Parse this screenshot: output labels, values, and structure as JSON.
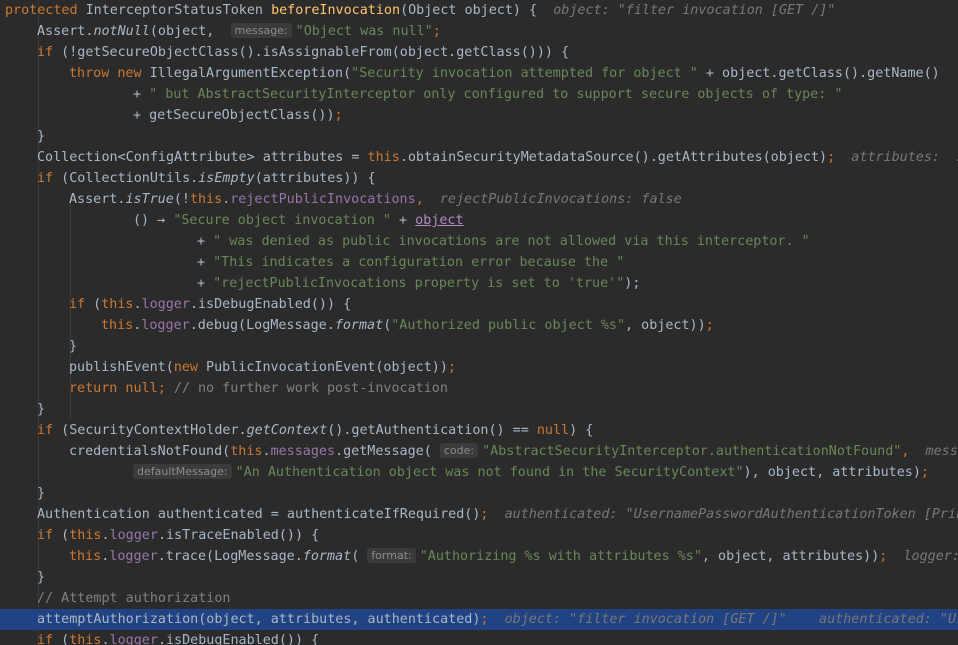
{
  "editor": {
    "language": "java",
    "colors": {
      "background": "#2b2b2b",
      "keyword": "#cc7832",
      "method_declaration": "#ffc66d",
      "string": "#6a8759",
      "field": "#9876aa",
      "comment": "#808080",
      "inlay_hint": "#787878",
      "current_line": "#214283"
    },
    "current_line_index": 29,
    "lines": [
      {
        "indent": 0,
        "tokens": [
          {
            "t": "protected",
            "c": "kw"
          },
          {
            "t": " "
          },
          {
            "t": "InterceptorStatusToken "
          },
          {
            "t": "beforeInvocation",
            "c": "fn"
          },
          {
            "t": "(Object object) {  "
          },
          {
            "t": "object: \"filter invocation [GET /]\"",
            "c": "hint"
          }
        ]
      },
      {
        "indent": 1,
        "tokens": [
          {
            "t": "Assert."
          },
          {
            "t": "notNull",
            "c": "it"
          },
          {
            "t": "(object,  "
          },
          {
            "t": "message:",
            "c": "param"
          },
          {
            "t": "\"Object was null\"",
            "c": "str"
          },
          {
            "t": ";",
            "c": "kw"
          }
        ]
      },
      {
        "indent": 1,
        "tokens": [
          {
            "t": "if",
            "c": "kw"
          },
          {
            "t": " (!getSecureObjectClass().isAssignableFrom(object.getClass())) {"
          }
        ]
      },
      {
        "indent": 2,
        "tokens": [
          {
            "t": "throw new",
            "c": "kw"
          },
          {
            "t": " IllegalArgumentException("
          },
          {
            "t": "\"Security invocation attempted for object \"",
            "c": "str"
          },
          {
            "t": " + object.getClass().getName()"
          }
        ]
      },
      {
        "indent": 4,
        "tokens": [
          {
            "t": "+ "
          },
          {
            "t": "\" but AbstractSecurityInterceptor only configured to support secure objects of type: \"",
            "c": "str"
          }
        ]
      },
      {
        "indent": 4,
        "tokens": [
          {
            "t": "+ getSecureObjectClass())"
          },
          {
            "t": ";",
            "c": "kw"
          }
        ]
      },
      {
        "indent": 1,
        "tokens": [
          {
            "t": "}"
          }
        ]
      },
      {
        "indent": 1,
        "tokens": [
          {
            "t": "Collection<ConfigAttribute> attributes = "
          },
          {
            "t": "this",
            "c": "kw"
          },
          {
            "t": ".obtainSecurityMetadataSource().getAttributes(object)"
          },
          {
            "t": ";",
            "c": "kw"
          },
          {
            "t": "  "
          },
          {
            "t": "attributes:  s",
            "c": "hint"
          }
        ]
      },
      {
        "indent": 1,
        "tokens": [
          {
            "t": "if",
            "c": "kw"
          },
          {
            "t": " (CollectionUtils."
          },
          {
            "t": "isEmpty",
            "c": "it"
          },
          {
            "t": "(attributes)) {"
          }
        ]
      },
      {
        "indent": 2,
        "tokens": [
          {
            "t": "Assert."
          },
          {
            "t": "isTrue",
            "c": "it"
          },
          {
            "t": "(!"
          },
          {
            "t": "this",
            "c": "kw"
          },
          {
            "t": "."
          },
          {
            "t": "rejectPublicInvocations",
            "c": "fld"
          },
          {
            "t": ",",
            "c": "kw"
          },
          {
            "t": "  "
          },
          {
            "t": "rejectPublicInvocations: false",
            "c": "hint"
          }
        ]
      },
      {
        "indent": 4,
        "tokens": [
          {
            "t": "() → "
          },
          {
            "t": "\"Secure object invocation \"",
            "c": "str"
          },
          {
            "t": " + "
          },
          {
            "t": "object",
            "c": "link"
          }
        ]
      },
      {
        "indent": 6,
        "tokens": [
          {
            "t": "+ "
          },
          {
            "t": "\" was denied as public invocations are not allowed via this interceptor. \"",
            "c": "str"
          }
        ]
      },
      {
        "indent": 6,
        "tokens": [
          {
            "t": "+ "
          },
          {
            "t": "\"This indicates a configuration error because the \"",
            "c": "str"
          }
        ]
      },
      {
        "indent": 6,
        "tokens": [
          {
            "t": "+ "
          },
          {
            "t": "\"rejectPublicInvocations property is set to 'true'\"",
            "c": "str"
          },
          {
            "t": ");"
          }
        ]
      },
      {
        "indent": 2,
        "tokens": [
          {
            "t": "if",
            "c": "kw"
          },
          {
            "t": " ("
          },
          {
            "t": "this",
            "c": "kw"
          },
          {
            "t": "."
          },
          {
            "t": "logger",
            "c": "fld"
          },
          {
            "t": ".isDebugEnabled()) {"
          }
        ]
      },
      {
        "indent": 3,
        "tokens": [
          {
            "t": "this",
            "c": "kw"
          },
          {
            "t": "."
          },
          {
            "t": "logger",
            "c": "fld"
          },
          {
            "t": ".debug(LogMessage."
          },
          {
            "t": "format",
            "c": "it"
          },
          {
            "t": "("
          },
          {
            "t": "\"Authorized public object %s\"",
            "c": "str"
          },
          {
            "t": ", object))"
          },
          {
            "t": ";",
            "c": "kw"
          }
        ]
      },
      {
        "indent": 2,
        "tokens": [
          {
            "t": "}"
          }
        ]
      },
      {
        "indent": 2,
        "tokens": [
          {
            "t": "publishEvent("
          },
          {
            "t": "new",
            "c": "kw"
          },
          {
            "t": " PublicInvocationEvent(object))"
          },
          {
            "t": ";",
            "c": "kw"
          }
        ]
      },
      {
        "indent": 2,
        "tokens": [
          {
            "t": "return null",
            "c": "kw"
          },
          {
            "t": ";",
            "c": "kw"
          },
          {
            "t": " "
          },
          {
            "t": "// no further work post-invocation",
            "c": "cmt"
          }
        ]
      },
      {
        "indent": 1,
        "tokens": [
          {
            "t": "}"
          }
        ]
      },
      {
        "indent": 1,
        "tokens": [
          {
            "t": "if",
            "c": "kw"
          },
          {
            "t": " (SecurityContextHolder."
          },
          {
            "t": "getContext",
            "c": "it"
          },
          {
            "t": "().getAuthentication() == "
          },
          {
            "t": "null",
            "c": "kw"
          },
          {
            "t": ") {"
          }
        ]
      },
      {
        "indent": 2,
        "tokens": [
          {
            "t": "credentialsNotFound("
          },
          {
            "t": "this",
            "c": "kw"
          },
          {
            "t": "."
          },
          {
            "t": "messages",
            "c": "fld"
          },
          {
            "t": ".getMessage( "
          },
          {
            "t": "code:",
            "c": "param"
          },
          {
            "t": "\"AbstractSecurityInterceptor.authenticationNotFound\"",
            "c": "str"
          },
          {
            "t": ",",
            "c": "kw"
          },
          {
            "t": "  "
          },
          {
            "t": "message",
            "c": "hint"
          }
        ]
      },
      {
        "indent": 4,
        "tokens": [
          {
            "t": "defaultMessage:",
            "c": "param"
          },
          {
            "t": "\"An Authentication object was not found in the SecurityContext\"",
            "c": "str"
          },
          {
            "t": "), object, attributes)"
          },
          {
            "t": ";",
            "c": "kw"
          }
        ]
      },
      {
        "indent": 1,
        "tokens": [
          {
            "t": "}"
          }
        ]
      },
      {
        "indent": 1,
        "tokens": [
          {
            "t": "Authentication authenticated = authenticateIfRequired()"
          },
          {
            "t": ";",
            "c": "kw"
          },
          {
            "t": "  "
          },
          {
            "t": "authenticated: \"UsernamePasswordAuthenticationToken [Prin",
            "c": "hint"
          }
        ]
      },
      {
        "indent": 1,
        "tokens": [
          {
            "t": "if",
            "c": "kw"
          },
          {
            "t": " ("
          },
          {
            "t": "this",
            "c": "kw"
          },
          {
            "t": "."
          },
          {
            "t": "logger",
            "c": "fld"
          },
          {
            "t": ".isTraceEnabled()) {"
          }
        ]
      },
      {
        "indent": 2,
        "tokens": [
          {
            "t": "this",
            "c": "kw"
          },
          {
            "t": "."
          },
          {
            "t": "logger",
            "c": "fld"
          },
          {
            "t": ".trace(LogMessage."
          },
          {
            "t": "format",
            "c": "it"
          },
          {
            "t": "( "
          },
          {
            "t": "format:",
            "c": "param"
          },
          {
            "t": "\"Authorizing %s with attributes %s\"",
            "c": "str"
          },
          {
            "t": ", object, attributes))"
          },
          {
            "t": ";",
            "c": "kw"
          },
          {
            "t": "  "
          },
          {
            "t": "logger: ",
            "c": "hint"
          }
        ]
      },
      {
        "indent": 1,
        "tokens": [
          {
            "t": "}"
          }
        ]
      },
      {
        "indent": 1,
        "tokens": [
          {
            "t": "// Attempt authorization",
            "c": "cmt"
          }
        ]
      },
      {
        "indent": 1,
        "tokens": [
          {
            "t": "attemptAuthorization(object, attributes, authenticated)"
          },
          {
            "t": ";",
            "c": "kw"
          },
          {
            "t": "  "
          },
          {
            "t": "object: \"filter invocation [GET /]\"    authenticated: \"Us",
            "c": "hint"
          }
        ]
      },
      {
        "indent": 1,
        "tokens": [
          {
            "t": "if",
            "c": "kw"
          },
          {
            "t": " ("
          },
          {
            "t": "this",
            "c": "kw"
          },
          {
            "t": "."
          },
          {
            "t": "logger",
            "c": "fld"
          },
          {
            "t": ".isDebugEnabled()) {"
          }
        ]
      }
    ]
  }
}
